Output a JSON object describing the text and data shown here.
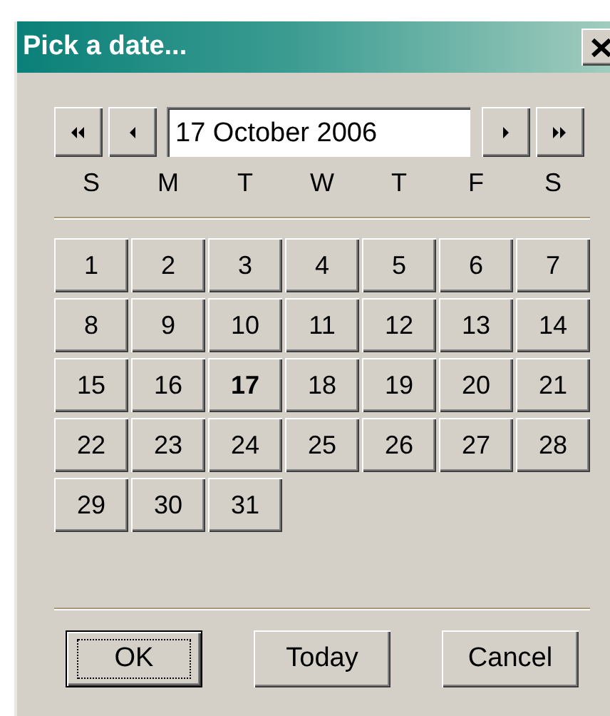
{
  "window": {
    "title": "Pick a date..."
  },
  "date_field": {
    "value": "17 October 2006"
  },
  "weekdays": [
    "S",
    "M",
    "T",
    "W",
    "T",
    "F",
    "S"
  ],
  "days": [
    {
      "label": "1",
      "selected": false
    },
    {
      "label": "2",
      "selected": false
    },
    {
      "label": "3",
      "selected": false
    },
    {
      "label": "4",
      "selected": false
    },
    {
      "label": "5",
      "selected": false
    },
    {
      "label": "6",
      "selected": false
    },
    {
      "label": "7",
      "selected": false
    },
    {
      "label": "8",
      "selected": false
    },
    {
      "label": "9",
      "selected": false
    },
    {
      "label": "10",
      "selected": false
    },
    {
      "label": "11",
      "selected": false
    },
    {
      "label": "12",
      "selected": false
    },
    {
      "label": "13",
      "selected": false
    },
    {
      "label": "14",
      "selected": false
    },
    {
      "label": "15",
      "selected": false
    },
    {
      "label": "16",
      "selected": false
    },
    {
      "label": "17",
      "selected": true
    },
    {
      "label": "18",
      "selected": false
    },
    {
      "label": "19",
      "selected": false
    },
    {
      "label": "20",
      "selected": false
    },
    {
      "label": "21",
      "selected": false
    },
    {
      "label": "22",
      "selected": false
    },
    {
      "label": "23",
      "selected": false
    },
    {
      "label": "24",
      "selected": false
    },
    {
      "label": "25",
      "selected": false
    },
    {
      "label": "26",
      "selected": false
    },
    {
      "label": "27",
      "selected": false
    },
    {
      "label": "28",
      "selected": false
    },
    {
      "label": "29",
      "selected": false
    },
    {
      "label": "30",
      "selected": false
    },
    {
      "label": "31",
      "selected": false
    }
  ],
  "buttons": [
    {
      "label": "OK",
      "default": true
    },
    {
      "label": "Today",
      "default": false
    },
    {
      "label": "Cancel",
      "default": false
    }
  ]
}
